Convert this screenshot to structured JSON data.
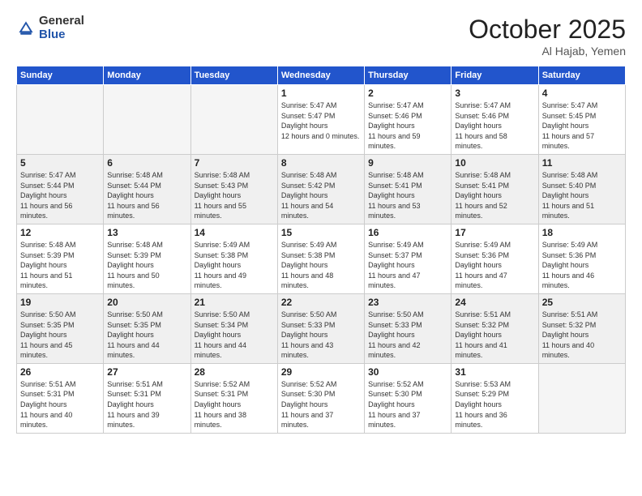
{
  "header": {
    "logo_general": "General",
    "logo_blue": "Blue",
    "month_title": "October 2025",
    "location": "Al Hajab, Yemen"
  },
  "days_of_week": [
    "Sunday",
    "Monday",
    "Tuesday",
    "Wednesday",
    "Thursday",
    "Friday",
    "Saturday"
  ],
  "weeks": [
    [
      {
        "day": "",
        "empty": true
      },
      {
        "day": "",
        "empty": true
      },
      {
        "day": "",
        "empty": true
      },
      {
        "day": "1",
        "sunrise": "5:47 AM",
        "sunset": "5:47 PM",
        "daylight": "12 hours and 0 minutes."
      },
      {
        "day": "2",
        "sunrise": "5:47 AM",
        "sunset": "5:46 PM",
        "daylight": "11 hours and 59 minutes."
      },
      {
        "day": "3",
        "sunrise": "5:47 AM",
        "sunset": "5:46 PM",
        "daylight": "11 hours and 58 minutes."
      },
      {
        "day": "4",
        "sunrise": "5:47 AM",
        "sunset": "5:45 PM",
        "daylight": "11 hours and 57 minutes."
      }
    ],
    [
      {
        "day": "5",
        "sunrise": "5:47 AM",
        "sunset": "5:44 PM",
        "daylight": "11 hours and 56 minutes."
      },
      {
        "day": "6",
        "sunrise": "5:48 AM",
        "sunset": "5:44 PM",
        "daylight": "11 hours and 56 minutes."
      },
      {
        "day": "7",
        "sunrise": "5:48 AM",
        "sunset": "5:43 PM",
        "daylight": "11 hours and 55 minutes."
      },
      {
        "day": "8",
        "sunrise": "5:48 AM",
        "sunset": "5:42 PM",
        "daylight": "11 hours and 54 minutes."
      },
      {
        "day": "9",
        "sunrise": "5:48 AM",
        "sunset": "5:41 PM",
        "daylight": "11 hours and 53 minutes."
      },
      {
        "day": "10",
        "sunrise": "5:48 AM",
        "sunset": "5:41 PM",
        "daylight": "11 hours and 52 minutes."
      },
      {
        "day": "11",
        "sunrise": "5:48 AM",
        "sunset": "5:40 PM",
        "daylight": "11 hours and 51 minutes."
      }
    ],
    [
      {
        "day": "12",
        "sunrise": "5:48 AM",
        "sunset": "5:39 PM",
        "daylight": "11 hours and 51 minutes."
      },
      {
        "day": "13",
        "sunrise": "5:48 AM",
        "sunset": "5:39 PM",
        "daylight": "11 hours and 50 minutes."
      },
      {
        "day": "14",
        "sunrise": "5:49 AM",
        "sunset": "5:38 PM",
        "daylight": "11 hours and 49 minutes."
      },
      {
        "day": "15",
        "sunrise": "5:49 AM",
        "sunset": "5:38 PM",
        "daylight": "11 hours and 48 minutes."
      },
      {
        "day": "16",
        "sunrise": "5:49 AM",
        "sunset": "5:37 PM",
        "daylight": "11 hours and 47 minutes."
      },
      {
        "day": "17",
        "sunrise": "5:49 AM",
        "sunset": "5:36 PM",
        "daylight": "11 hours and 47 minutes."
      },
      {
        "day": "18",
        "sunrise": "5:49 AM",
        "sunset": "5:36 PM",
        "daylight": "11 hours and 46 minutes."
      }
    ],
    [
      {
        "day": "19",
        "sunrise": "5:50 AM",
        "sunset": "5:35 PM",
        "daylight": "11 hours and 45 minutes."
      },
      {
        "day": "20",
        "sunrise": "5:50 AM",
        "sunset": "5:35 PM",
        "daylight": "11 hours and 44 minutes."
      },
      {
        "day": "21",
        "sunrise": "5:50 AM",
        "sunset": "5:34 PM",
        "daylight": "11 hours and 44 minutes."
      },
      {
        "day": "22",
        "sunrise": "5:50 AM",
        "sunset": "5:33 PM",
        "daylight": "11 hours and 43 minutes."
      },
      {
        "day": "23",
        "sunrise": "5:50 AM",
        "sunset": "5:33 PM",
        "daylight": "11 hours and 42 minutes."
      },
      {
        "day": "24",
        "sunrise": "5:51 AM",
        "sunset": "5:32 PM",
        "daylight": "11 hours and 41 minutes."
      },
      {
        "day": "25",
        "sunrise": "5:51 AM",
        "sunset": "5:32 PM",
        "daylight": "11 hours and 40 minutes."
      }
    ],
    [
      {
        "day": "26",
        "sunrise": "5:51 AM",
        "sunset": "5:31 PM",
        "daylight": "11 hours and 40 minutes."
      },
      {
        "day": "27",
        "sunrise": "5:51 AM",
        "sunset": "5:31 PM",
        "daylight": "11 hours and 39 minutes."
      },
      {
        "day": "28",
        "sunrise": "5:52 AM",
        "sunset": "5:31 PM",
        "daylight": "11 hours and 38 minutes."
      },
      {
        "day": "29",
        "sunrise": "5:52 AM",
        "sunset": "5:30 PM",
        "daylight": "11 hours and 37 minutes."
      },
      {
        "day": "30",
        "sunrise": "5:52 AM",
        "sunset": "5:30 PM",
        "daylight": "11 hours and 37 minutes."
      },
      {
        "day": "31",
        "sunrise": "5:53 AM",
        "sunset": "5:29 PM",
        "daylight": "11 hours and 36 minutes."
      },
      {
        "day": "",
        "empty": true
      }
    ]
  ]
}
